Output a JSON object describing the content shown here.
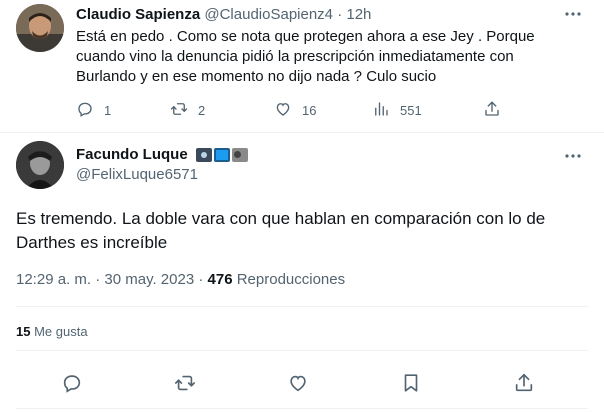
{
  "reply": {
    "name": "Claudio Sapienza",
    "handle": "@ClaudioSapienz4",
    "separator": "·",
    "time": "12h",
    "text": "Está en pedo . Como se nota que protegen ahora a ese Jey . Porque cuando vino la denuncia pidió la prescripción inmediatamente con Burlando y en ese momento no dijo nada ? Culo sucio",
    "replies": "1",
    "retweets": "2",
    "likes": "16",
    "views": "551"
  },
  "main": {
    "name": "Facundo Luque",
    "name_emojis": [
      "camera-emoji",
      "tv-emoji",
      "radio-emoji"
    ],
    "handle": "@FelixLuque6571",
    "text": "Es tremendo. La doble vara con que hablan en comparación con lo de Darthes es increíble",
    "time": "12:29 a. m.",
    "separator": "·",
    "date": "30 may. 2023",
    "views_count": "476",
    "views_label": "Reproducciones",
    "likes_count": "15",
    "likes_label": "Me gusta"
  },
  "colors": {
    "text": "#0f1419",
    "muted": "#536471",
    "border": "#eff3f4"
  }
}
